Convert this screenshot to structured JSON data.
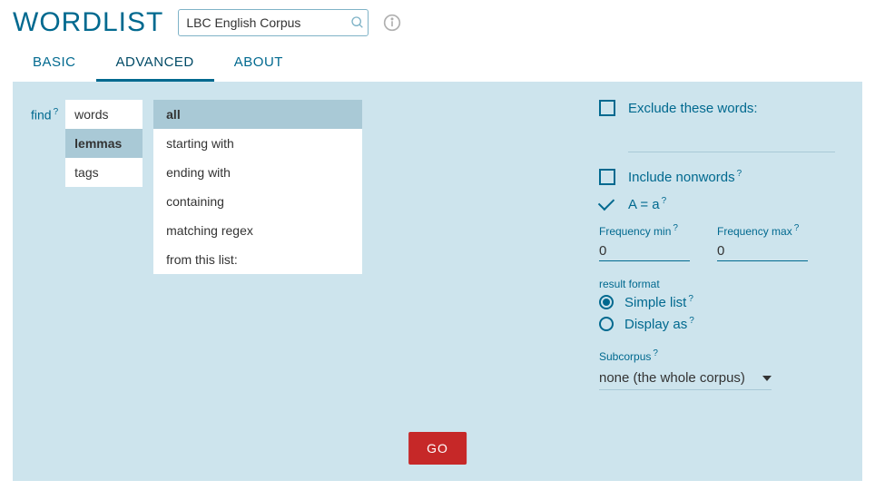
{
  "header": {
    "title": "WORDLIST",
    "corpus": "LBC English Corpus"
  },
  "tabs": {
    "basic": "BASIC",
    "advanced": "ADVANCED",
    "about": "ABOUT",
    "active": "advanced"
  },
  "find": {
    "label": "find",
    "types": [
      "words",
      "lemmas",
      "tags"
    ],
    "types_selected": 1,
    "filters": [
      "all",
      "starting with",
      "ending with",
      "containing",
      "matching regex",
      "from this list:"
    ],
    "filters_selected": 0
  },
  "options": {
    "exclude_label": "Exclude these words:",
    "include_nonwords_label": "Include nonwords",
    "case_label": "A = a",
    "freq_min_label": "Frequency min",
    "freq_max_label": "Frequency max",
    "freq_min": "0",
    "freq_max": "0",
    "result_format_label": "result format",
    "simple_list_label": "Simple list",
    "display_as_label": "Display as",
    "result_format_selected": "simple",
    "subcorpus_label": "Subcorpus",
    "subcorpus_value": "none (the whole corpus)"
  },
  "actions": {
    "go": "GO"
  }
}
